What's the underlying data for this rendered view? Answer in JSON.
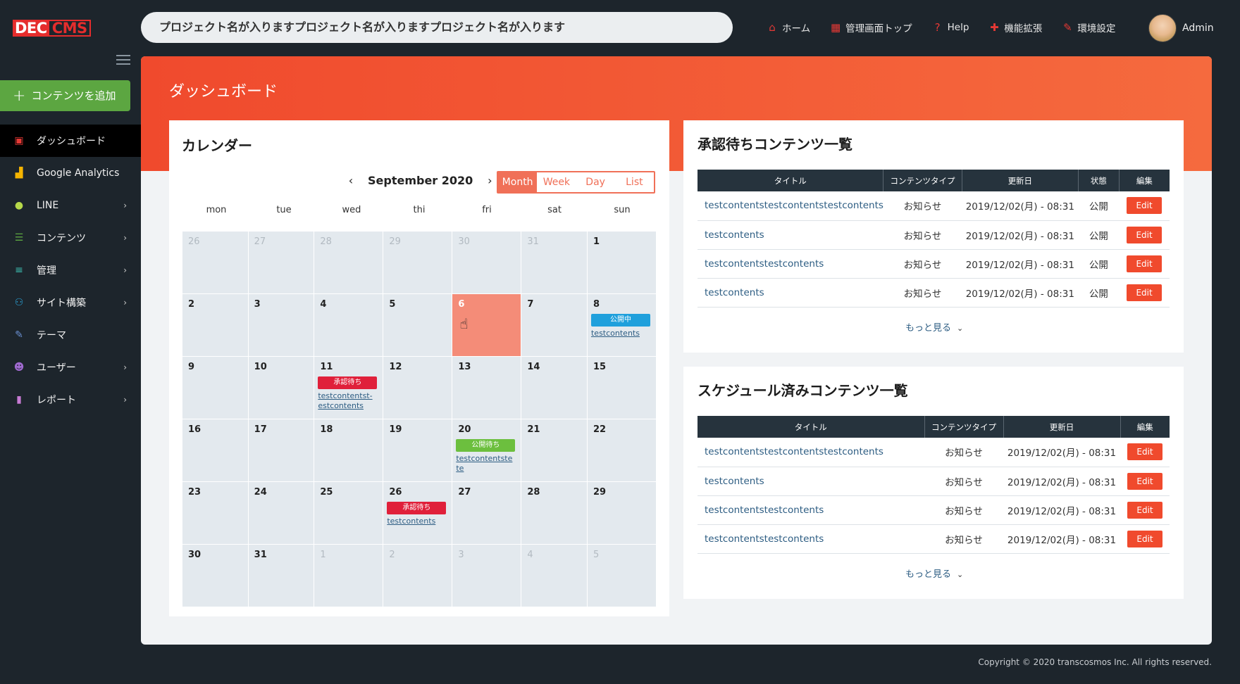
{
  "app": {
    "logo_left": "DEC",
    "logo_right": "CMS"
  },
  "header": {
    "project": "プロジェクト名が入りますプロジェクト名が入りますプロジェクト名が入ります",
    "nav": [
      {
        "label": "ホーム",
        "icon": "home-icon",
        "glyph": "⌂"
      },
      {
        "label": "管理画面トップ",
        "icon": "grid-icon",
        "glyph": "▦"
      },
      {
        "label": "Help",
        "icon": "help-icon",
        "glyph": "?"
      },
      {
        "label": "機能拡張",
        "icon": "puzzle-icon",
        "glyph": "✚"
      },
      {
        "label": "環境設定",
        "icon": "wrench-icon",
        "glyph": "✎"
      }
    ],
    "user": "Admin"
  },
  "sidebar": {
    "add_label": "コンテンツを追加",
    "items": [
      {
        "label": "ダッシュボード",
        "icon": "dashboard-icon",
        "glyph": "▣",
        "color": "#e53935",
        "chev": false,
        "active": true
      },
      {
        "label": "Google Analytics",
        "icon": "analytics-icon",
        "glyph": "▟",
        "color": "#f5b400",
        "chev": false,
        "active": false
      },
      {
        "label": "LINE",
        "icon": "line-icon",
        "glyph": "●",
        "color": "#b6d84a",
        "chev": true,
        "active": false
      },
      {
        "label": "コンテンツ",
        "icon": "contents-icon",
        "glyph": "☰",
        "color": "#5ca641",
        "chev": true,
        "active": false
      },
      {
        "label": "管理",
        "icon": "sliders-icon",
        "glyph": "≡",
        "color": "#3dbdb0",
        "chev": true,
        "active": false
      },
      {
        "label": "サイト構築",
        "icon": "sitemap-icon",
        "glyph": "⚇",
        "color": "#2aa3d8",
        "chev": true,
        "active": false
      },
      {
        "label": "テーマ",
        "icon": "brush-icon",
        "glyph": "✎",
        "color": "#6a8fd0",
        "chev": false,
        "active": false
      },
      {
        "label": "ユーザー",
        "icon": "users-icon",
        "glyph": "☻",
        "color": "#a06ad0",
        "chev": true,
        "active": false
      },
      {
        "label": "レポート",
        "icon": "report-icon",
        "glyph": "▮",
        "color": "#c77bd4",
        "chev": true,
        "active": false
      }
    ]
  },
  "page": {
    "title": "ダッシュボード"
  },
  "calendar": {
    "title": "カレンダー",
    "month": "September 2020",
    "prev": "‹",
    "next": "›",
    "views": [
      "Month",
      "Week",
      "Day",
      "List"
    ],
    "active_view": "Month",
    "weekdays": [
      "mon",
      "tue",
      "wed",
      "thi",
      "fri",
      "sat",
      "sun"
    ],
    "days": [
      {
        "d": "26",
        "other": true
      },
      {
        "d": "27",
        "other": true
      },
      {
        "d": "28",
        "other": true
      },
      {
        "d": "29",
        "other": true
      },
      {
        "d": "30",
        "other": true
      },
      {
        "d": "31",
        "other": true
      },
      {
        "d": "1"
      },
      {
        "d": "2"
      },
      {
        "d": "3"
      },
      {
        "d": "4"
      },
      {
        "d": "5"
      },
      {
        "d": "6",
        "today": true
      },
      {
        "d": "7"
      },
      {
        "d": "8",
        "event": {
          "badge": "公開中",
          "color": "#1fa0dc",
          "link": "testcontents"
        }
      },
      {
        "d": "9"
      },
      {
        "d": "10"
      },
      {
        "d": "11",
        "event": {
          "badge": "承認待ち",
          "color": "#e0203a",
          "link": "testcontentst-estcontents"
        }
      },
      {
        "d": "12"
      },
      {
        "d": "13"
      },
      {
        "d": "14"
      },
      {
        "d": "15"
      },
      {
        "d": "16"
      },
      {
        "d": "17"
      },
      {
        "d": "18"
      },
      {
        "d": "19"
      },
      {
        "d": "20",
        "event": {
          "badge": "公開待ち",
          "color": "#6cbf3e",
          "link": "testcontentstete"
        }
      },
      {
        "d": "21"
      },
      {
        "d": "22"
      },
      {
        "d": "23"
      },
      {
        "d": "24"
      },
      {
        "d": "25"
      },
      {
        "d": "26",
        "event": {
          "badge": "承認待ち",
          "color": "#e0203a",
          "link": "testcontents"
        }
      },
      {
        "d": "27"
      },
      {
        "d": "28"
      },
      {
        "d": "29"
      },
      {
        "d": "30"
      },
      {
        "d": "31"
      },
      {
        "d": "1",
        "other": true
      },
      {
        "d": "2",
        "other": true
      },
      {
        "d": "3",
        "other": true
      },
      {
        "d": "4",
        "other": true
      },
      {
        "d": "5",
        "other": true
      }
    ]
  },
  "pending": {
    "title": "承認待ちコンテンツ一覧",
    "headers": [
      "タイトル",
      "コンテンツタイプ",
      "更新日",
      "状態",
      "編集"
    ],
    "rows": [
      {
        "title": "testcontentstestcontentstestcontents",
        "type": "お知らせ",
        "date": "2019/12/02(月) - 08:31",
        "status": "公開",
        "edit": "Edit"
      },
      {
        "title": "testcontents",
        "type": "お知らせ",
        "date": "2019/12/02(月) - 08:31",
        "status": "公開",
        "edit": "Edit"
      },
      {
        "title": "testcontentstestcontents",
        "type": "お知らせ",
        "date": "2019/12/02(月) - 08:31",
        "status": "公開",
        "edit": "Edit"
      },
      {
        "title": "testcontents",
        "type": "お知らせ",
        "date": "2019/12/02(月) - 08:31",
        "status": "公開",
        "edit": "Edit"
      }
    ],
    "more": "もっと見る"
  },
  "scheduled": {
    "title": "スケジュール済みコンテンツ一覧",
    "headers": [
      "タイトル",
      "コンテンツタイプ",
      "更新日",
      "編集"
    ],
    "rows": [
      {
        "title": "testcontentstestcontentstestcontents",
        "type": "お知らせ",
        "date": "2019/12/02(月) - 08:31",
        "edit": "Edit"
      },
      {
        "title": "testcontents",
        "type": "お知らせ",
        "date": "2019/12/02(月) - 08:31",
        "edit": "Edit"
      },
      {
        "title": "testcontentstestcontents",
        "type": "お知らせ",
        "date": "2019/12/02(月) - 08:31",
        "edit": "Edit"
      },
      {
        "title": "testcontentstestcontents",
        "type": "お知らせ",
        "date": "2019/12/02(月) - 08:31",
        "edit": "Edit"
      }
    ],
    "more": "もっと見る"
  },
  "footer": {
    "copyright": "Copyright © 2020 transcosmos Inc. All rights reserved."
  }
}
